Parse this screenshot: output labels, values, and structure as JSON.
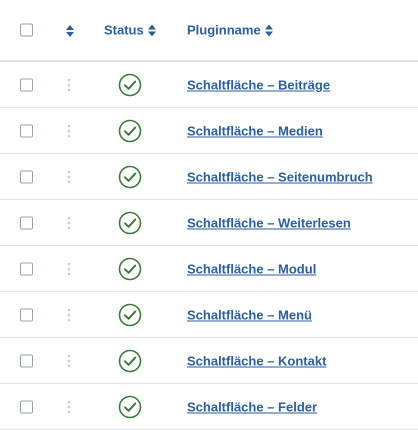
{
  "header": {
    "status_label": "Status",
    "name_label": "Pluginname"
  },
  "plugins": [
    {
      "name": "Schaltfläche – Beiträge",
      "status": "enabled"
    },
    {
      "name": "Schaltfläche – Medien",
      "status": "enabled"
    },
    {
      "name": "Schaltfläche – Seitenumbruch",
      "status": "enabled"
    },
    {
      "name": "Schaltfläche – Weiterlesen",
      "status": "enabled"
    },
    {
      "name": "Schaltfläche – Modul",
      "status": "enabled"
    },
    {
      "name": "Schaltfläche – Menü",
      "status": "enabled"
    },
    {
      "name": "Schaltfläche – Kontakt",
      "status": "enabled"
    },
    {
      "name": "Schaltfläche – Felder",
      "status": "enabled"
    }
  ],
  "colors": {
    "link": "#2a5ea5",
    "status_enabled": "#3b7d3b",
    "border": "#dfe3e7",
    "drag_handle": "#c9ced3"
  },
  "icons": {
    "sort": "sort-icon",
    "status_enabled": "check-circle-icon",
    "drag": "drag-handle-icon"
  }
}
